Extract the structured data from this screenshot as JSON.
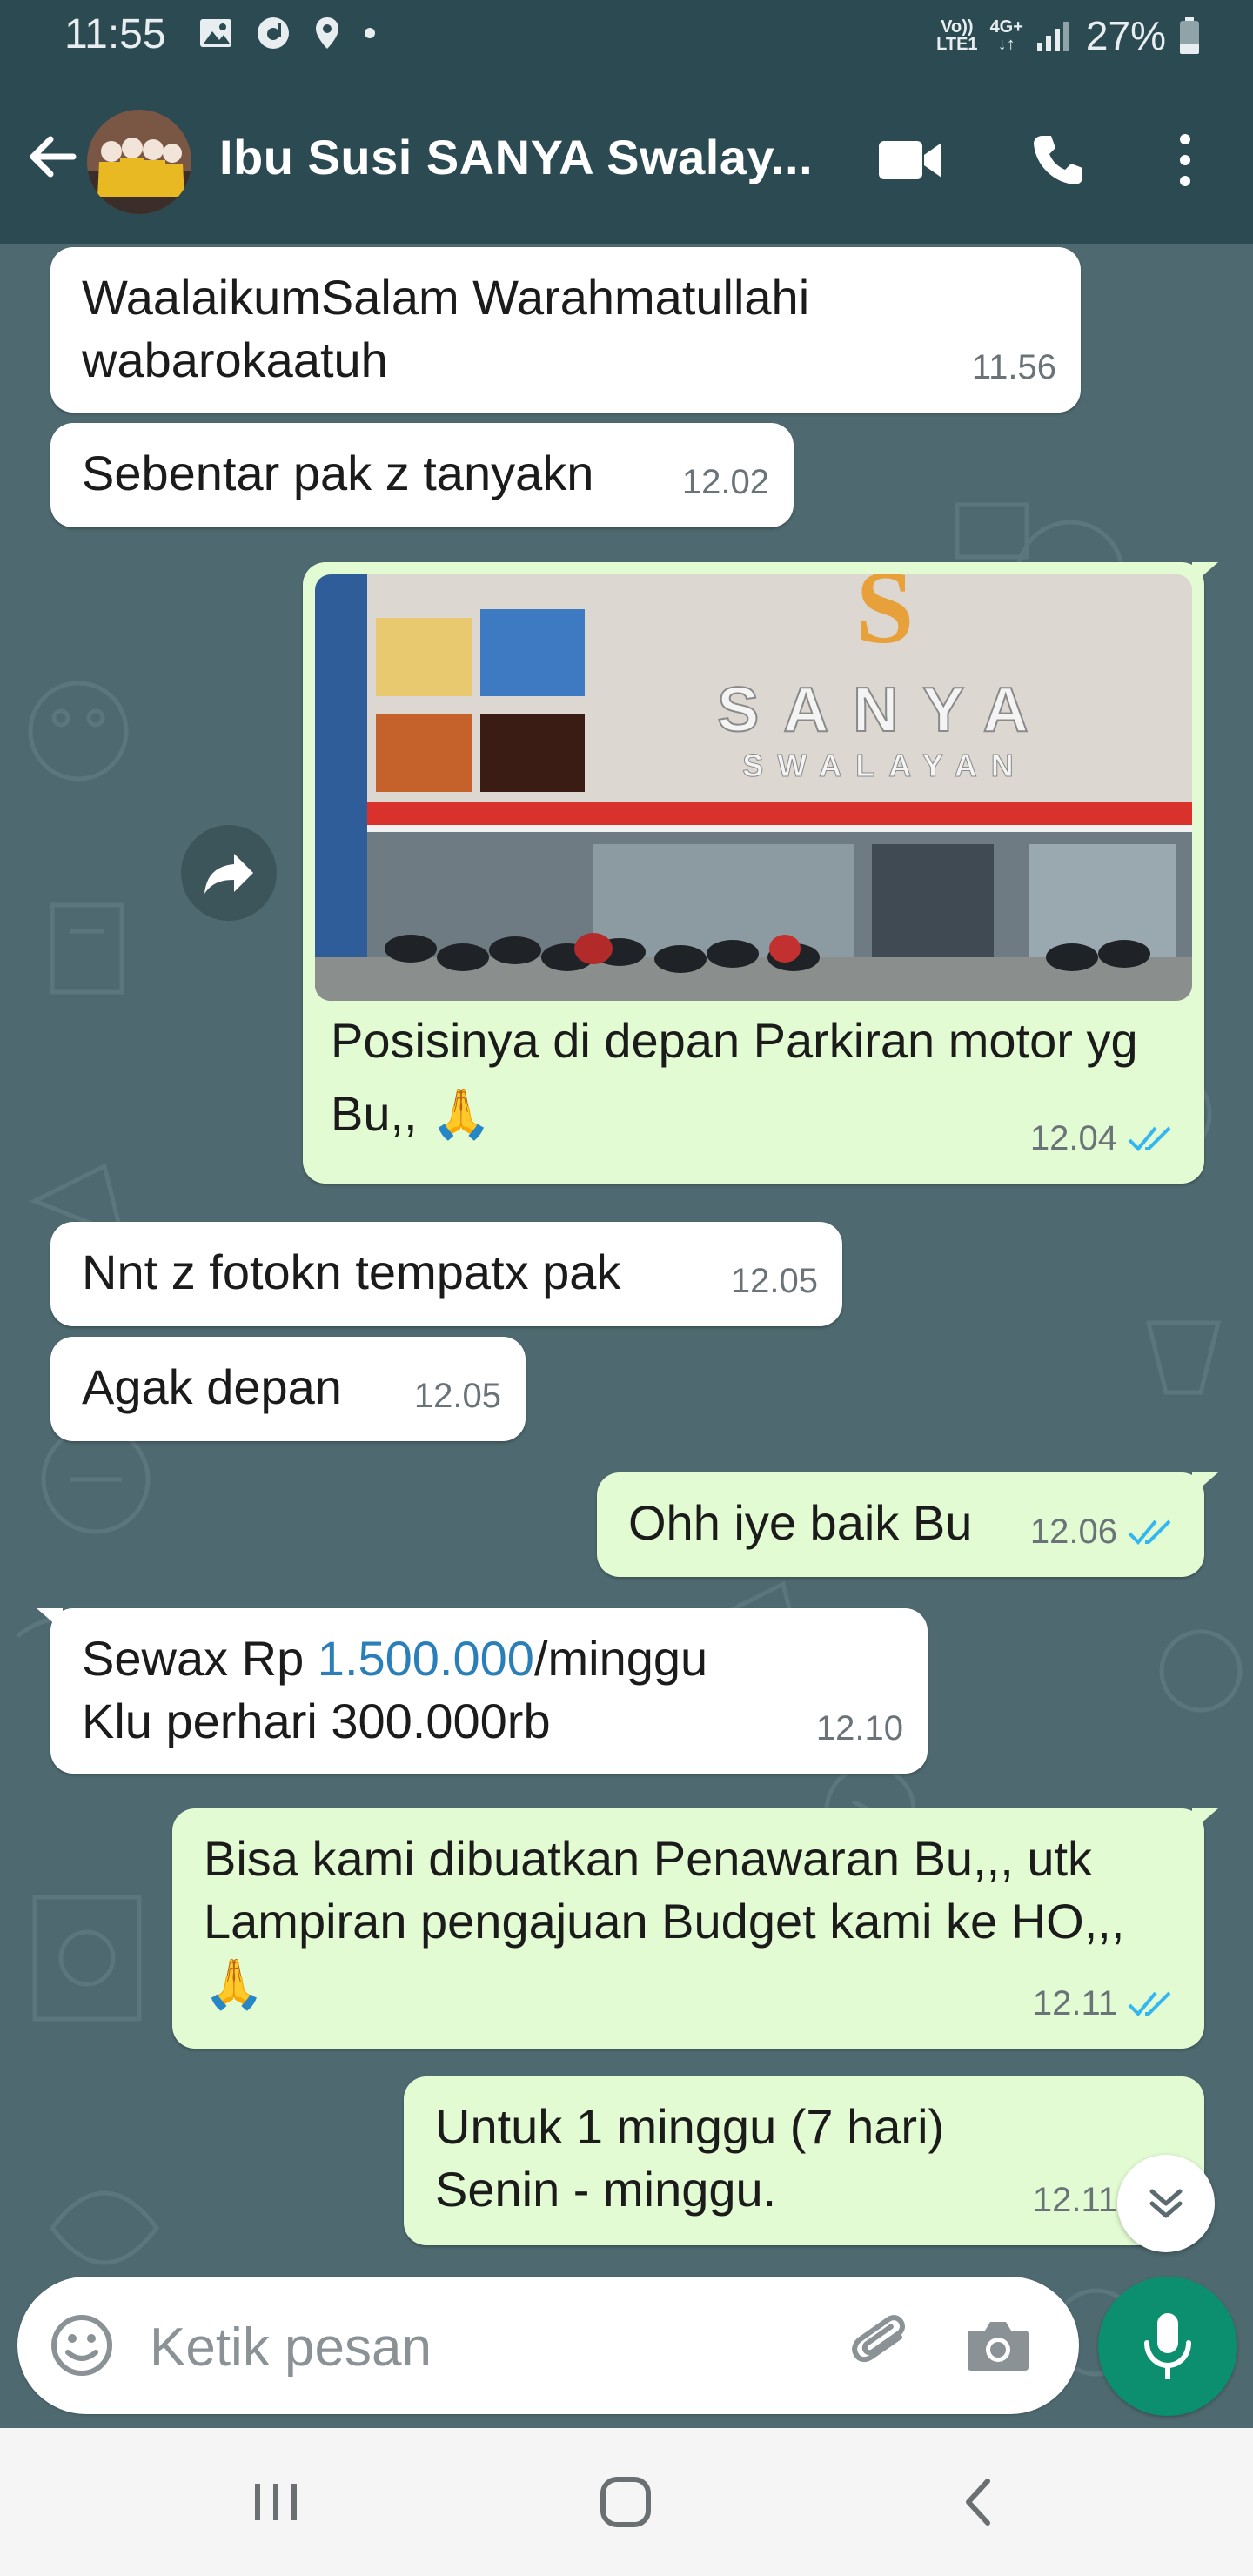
{
  "status_bar": {
    "time": "11:55",
    "network_top": "Vo))",
    "network_bottom": "LTE1",
    "data_type": "4G+",
    "battery": "27%"
  },
  "header": {
    "title": "Ibu Susi SANYA Swalay..."
  },
  "messages": [
    {
      "id": "m1",
      "direction": "incoming",
      "text": "WaalaikumSalam Warahmatullahi wabarokaatuh",
      "time": "11.56"
    },
    {
      "id": "m2",
      "direction": "incoming",
      "text": "Sebentar pak z tanyakn",
      "time": "12.02"
    },
    {
      "id": "m3",
      "direction": "outgoing",
      "type": "image",
      "caption": "Posisinya di depan Parkiran motor yg Bu,, 🙏",
      "time": "12.04",
      "read": true,
      "photo_sign_main": "SANYA",
      "photo_sign_sub": "SWALAYAN",
      "photo_logo_letter": "S"
    },
    {
      "id": "m4",
      "direction": "incoming",
      "text": "Nnt z fotokn tempatx pak",
      "time": "12.05"
    },
    {
      "id": "m5",
      "direction": "incoming",
      "text": "Agak depan",
      "time": "12.05"
    },
    {
      "id": "m6",
      "direction": "outgoing",
      "text": "Ohh iye baik Bu",
      "time": "12.06",
      "read": true
    },
    {
      "id": "m7",
      "direction": "incoming",
      "text_before": "Sewax Rp ",
      "link": "1.500.000",
      "text_after": "/minggu",
      "line2": "Klu perhari 300.000rb",
      "time": "12.10"
    },
    {
      "id": "m8",
      "direction": "outgoing",
      "text": "Bisa kami dibuatkan Penawaran Bu,,, utk Lampiran pengajuan Budget kami ke HO,,, 🙏",
      "time": "12.11",
      "read": true
    },
    {
      "id": "m9",
      "direction": "outgoing",
      "text": "Untuk 1 minggu (7 hari) Senin - minggu.",
      "time": "12.11",
      "read": true
    }
  ],
  "composer": {
    "placeholder": "Ketik pesan"
  },
  "colors": {
    "header": "#2c4a52",
    "chat_background": "#4e6a70",
    "incoming_bubble": "#ffffff",
    "outgoing_bubble": "#e2fbd2",
    "read_ticks": "#34b7f1",
    "mic_button": "#0b8f6f",
    "link": "#2b7fb8"
  },
  "icons": [
    "image-icon",
    "signal-icon",
    "location-icon",
    "battery-icon",
    "back-arrow-icon",
    "video-call-icon",
    "phone-icon",
    "more-vert-icon",
    "forward-icon",
    "double-chevron-down-icon",
    "emoji-icon",
    "paperclip-icon",
    "camera-icon",
    "mic-icon",
    "recents-icon",
    "home-icon",
    "nav-back-icon"
  ]
}
